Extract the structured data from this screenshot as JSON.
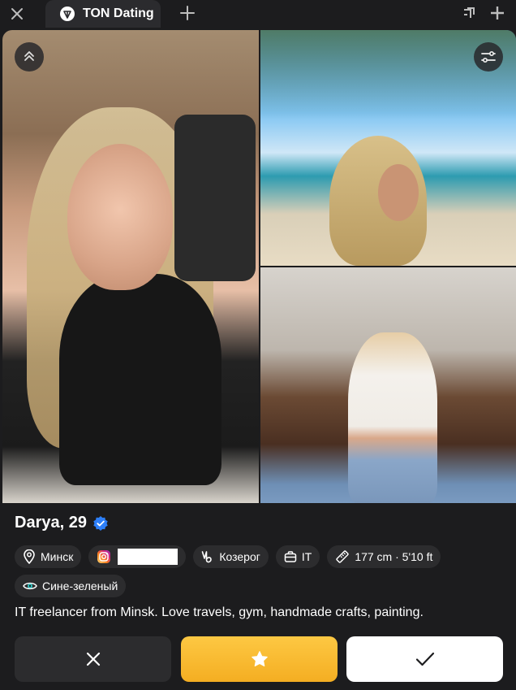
{
  "window": {
    "tab_title": "TON Dating",
    "icons": [
      "close-icon",
      "ton-logo-icon",
      "plus-icon",
      "minimize-icon",
      "maximize-icon"
    ]
  },
  "photos": {
    "items": [
      "main-photo",
      "beach-photo",
      "kitchen-photo"
    ],
    "overlay_buttons": [
      "collapse-icon",
      "filter-icon"
    ]
  },
  "profile": {
    "name_age": "Darya, 29",
    "verified": true,
    "chips": {
      "city": "Минск",
      "instagram_handle": "",
      "zodiac": "Козерог",
      "profession": "IT",
      "height": "177 cm · 5'10 ft",
      "eye_color": "Сине-зеленый"
    },
    "bio": "IT freelancer from Minsk. Love travels, gym, handmade crafts, painting."
  },
  "actions": {
    "dislike_icon": "close-icon",
    "superlike_icon": "star-icon",
    "like_icon": "check-icon"
  },
  "colors": {
    "background": "#1c1c1e",
    "chip": "#2c2c2e",
    "superlike": "#f4ae22",
    "verified": "#2d7ff9"
  }
}
